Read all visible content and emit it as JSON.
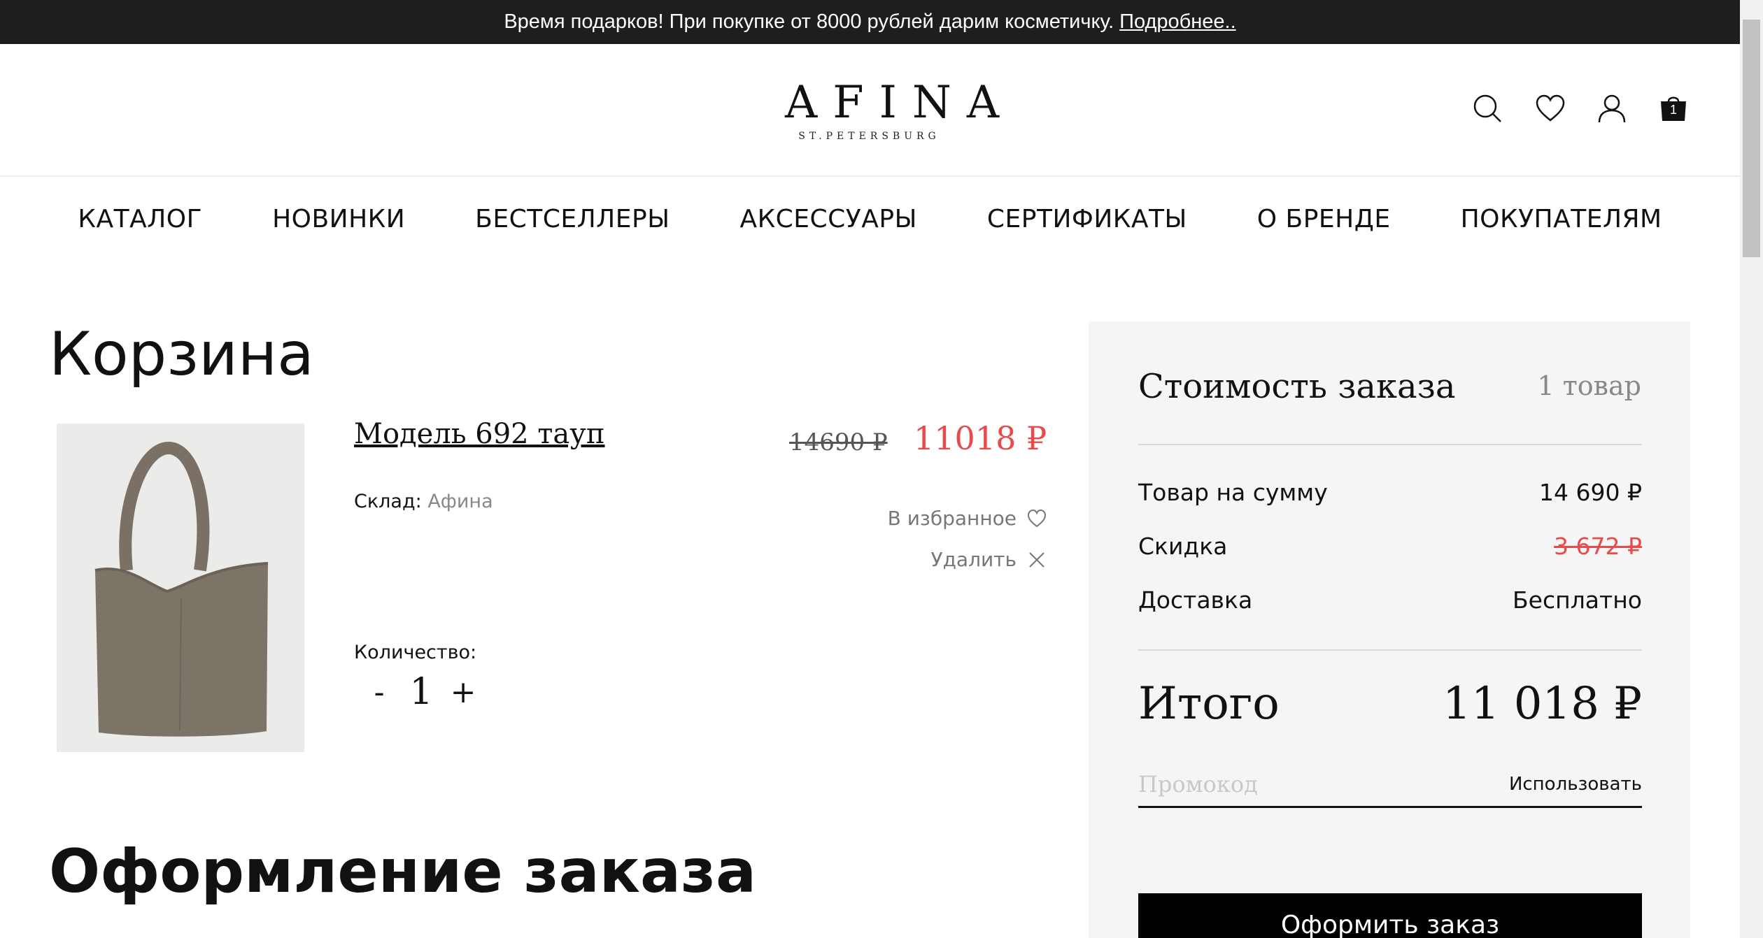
{
  "promo_bar": {
    "text": "Время подарков! При покупке от 8000 рублей дарим косметичку.",
    "link": "Подробнее.."
  },
  "header": {
    "logo_main": "AFINA",
    "logo_sub": "ST.PETERSBURG",
    "cart_count": "1",
    "icons": [
      "search-icon",
      "heart-icon",
      "user-icon",
      "cart-icon"
    ]
  },
  "nav": {
    "items": [
      {
        "label": "КАТАЛОГ"
      },
      {
        "label": "НОВИНКИ"
      },
      {
        "label": "БЕСТСЕЛЛЕРЫ"
      },
      {
        "label": "АКСЕССУАРЫ"
      },
      {
        "label": "СЕРТИФИКАТЫ"
      },
      {
        "label": "О БРЕНДЕ"
      },
      {
        "label": "ПОКУПАТЕЛЯМ"
      }
    ]
  },
  "cart": {
    "title": "Корзина",
    "item": {
      "name": "Модель 692 тауп",
      "old_price": "14690 ₽",
      "new_price": "11018 ₽",
      "stock_label": "Склад:",
      "stock_value": "Афина",
      "favorite_label": "В избранное",
      "delete_label": "Удалить",
      "qty_label": "Количество:",
      "qty_minus": "-",
      "qty_value": "1",
      "qty_plus": "+"
    }
  },
  "checkout": {
    "title": "Оформление заказа"
  },
  "summary": {
    "title": "Стоимость заказа",
    "count": "1 товар",
    "rows": [
      {
        "label": "Товар на сумму",
        "value": "14 690 ₽"
      },
      {
        "label": "Скидка",
        "value": "3 672 ₽"
      },
      {
        "label": "Доставка",
        "value": "Бесплатно"
      }
    ],
    "total_label": "Итого",
    "total_value": "11 018 ₽",
    "promo_placeholder": "Промокод",
    "promo_apply": "Использовать",
    "order_button": "Оформить заказ"
  },
  "colors": {
    "accent_red": "#e84b4b",
    "promo_bg": "#1e1e1e",
    "summary_bg": "#f5f5f5"
  }
}
